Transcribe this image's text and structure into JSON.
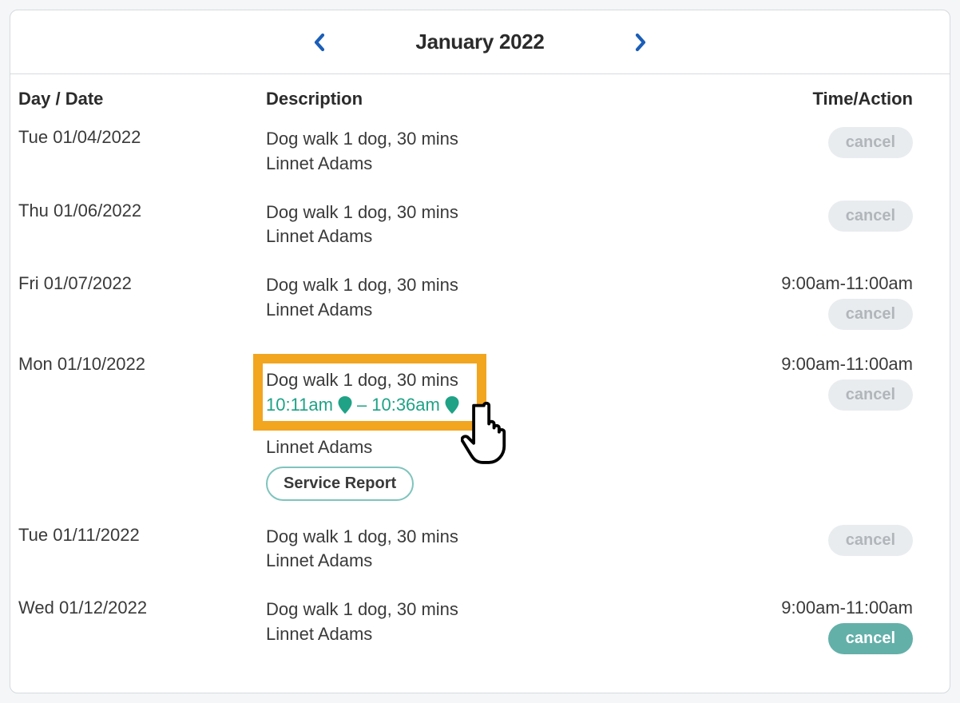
{
  "header": {
    "title": "January 2022"
  },
  "columns": {
    "day_date": "Day / Date",
    "description": "Description",
    "time_action": "Time/Action"
  },
  "cancel_label": "cancel",
  "service_report_label": "Service Report",
  "rows": [
    {
      "date": "Tue 01/04/2022",
      "desc_line1": "Dog walk 1 dog, 30 mins",
      "person": "Linnet Adams",
      "time": "",
      "cancel_active": false,
      "highlighted": false
    },
    {
      "date": "Thu 01/06/2022",
      "desc_line1": "Dog walk 1 dog, 30 mins",
      "person": "Linnet Adams",
      "time": "",
      "cancel_active": false,
      "highlighted": false
    },
    {
      "date": "Fri 01/07/2022",
      "desc_line1": "Dog walk 1 dog, 30 mins",
      "person": "Linnet Adams",
      "time": "9:00am-11:00am",
      "cancel_active": false,
      "highlighted": false
    },
    {
      "date": "Mon 01/10/2022",
      "desc_line1": "Dog walk 1 dog, 30 mins",
      "person": "Linnet Adams",
      "time": "9:00am-11:00am",
      "cancel_active": false,
      "highlighted": true,
      "timestamp_start": "10:11am",
      "timestamp_sep": "–",
      "timestamp_end": "10:36am",
      "show_report": true
    },
    {
      "date": "Tue 01/11/2022",
      "desc_line1": "Dog walk 1 dog, 30 mins",
      "person": "Linnet Adams",
      "time": "",
      "cancel_active": false,
      "highlighted": false
    },
    {
      "date": "Wed 01/12/2022",
      "desc_line1": "Dog walk 1 dog, 30 mins",
      "person": "Linnet Adams",
      "time": "9:00am-11:00am",
      "cancel_active": true,
      "highlighted": false
    }
  ]
}
